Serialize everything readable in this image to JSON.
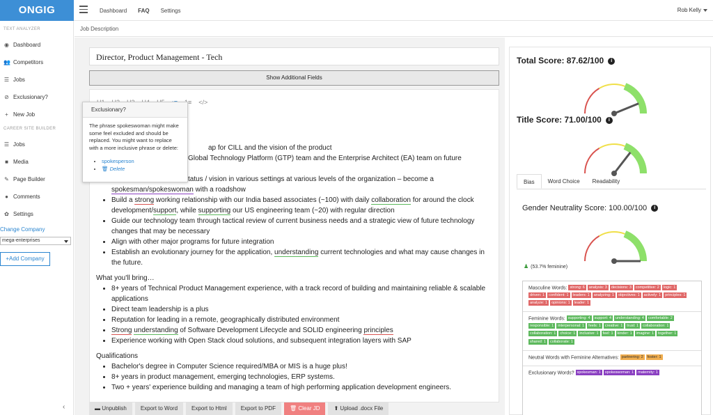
{
  "brand": {
    "logo": "ONGIG",
    "color": "#3d8fd6"
  },
  "nav": {
    "items": [
      "Dashboard",
      "FAQ",
      "Settings"
    ],
    "active": "FAQ",
    "user": "Rob Kelly"
  },
  "sidebar": {
    "section1": "TEXT ANALYZER",
    "items1": [
      {
        "icon": "dashboard-icon",
        "glyph": "◉",
        "label": "Dashboard"
      },
      {
        "icon": "users-icon",
        "glyph": "👥",
        "label": "Competitors"
      },
      {
        "icon": "list-icon",
        "glyph": "☰",
        "label": "Jobs"
      },
      {
        "icon": "ban-icon",
        "glyph": "⊘",
        "label": "Exclusionary?"
      },
      {
        "icon": "plus-icon",
        "glyph": "+",
        "label": "New Job"
      }
    ],
    "section2": "CAREER SITE BUILDER",
    "items2": [
      {
        "icon": "list-icon",
        "glyph": "☰",
        "label": "Jobs"
      },
      {
        "icon": "video-icon",
        "glyph": "■",
        "label": "Media"
      },
      {
        "icon": "wrench-icon",
        "glyph": "✎",
        "label": "Page Builder"
      },
      {
        "icon": "comment-icon",
        "glyph": "●",
        "label": "Comments"
      },
      {
        "icon": "gear-icon",
        "glyph": "✿",
        "label": "Settings"
      }
    ],
    "change_company": "Change Company",
    "company": "mega-enterprises",
    "add_company": "+Add Company"
  },
  "breadcrumb": "Job Description",
  "editor": {
    "title": "Director, Product Management - Tech",
    "show_fields": "Show Additional Fields",
    "toolbar": [
      "H1",
      "H2",
      "H3",
      "H4",
      "H5",
      "•≡",
      "1≡",
      "</>"
    ]
  },
  "popup": {
    "heading": "Exclusionary?",
    "body": "The phrase spokeswoman might make some feel excluded and should be replaced. You might want to replace with a more inclusive phrase or delete:",
    "option1": "spokesperson",
    "option2": "Delete"
  },
  "doc": {
    "line1_tail": "ap for CILL and the vision of the product",
    "line2_tail": "Global Technology Platform (GTP) team and the Enterprise Architect (EA) team on future",
    "line3_tail": "tatus / vision in various settings at various levels of the organization – become a",
    "line4_mark": "spokesman/spokeswoman",
    "line4_tail": " with a roadshow",
    "b2_a": "Build a ",
    "b2_strong": "strong",
    "b2_b": " working relationship with our India based associates (~100) with daily ",
    "b2_collab": "collaboration",
    "b2_c": " for around the clock development/",
    "b2_support": "support",
    "b2_d": ", while ",
    "b2_supporting": "supporting",
    "b2_e": " our US engineering team (~20) with regular direction",
    "b3": "Guide our technology team through tactical review of current business needs and a strategic view of future technology changes that may be necessary",
    "b4": "Align with other major programs for future integration",
    "b5_a": "Establish an evolutionary journey for the application, ",
    "b5_understanding": "understanding",
    "b5_b": " current technologies and what may cause changes in the future.",
    "section2": "What you'll bring…",
    "s2b1": "8+ years of Technical Product Management experience, with a track record of building and maintaining reliable & scalable applications",
    "s2b2": "Direct team leadership is a plus",
    "s2b3": "Reputation for leading in a remote, geographically distributed environment",
    "s2b4_strong": "Strong",
    "s2b4_understanding": "understanding",
    "s2b4_a": " of Software Development Lifecycle and SOLID engineering ",
    "s2b4_principles": "principles",
    "s2b5": "Experience working with Open Stack cloud solutions, and subsequent integration layers with SAP",
    "section3": "Qualifications",
    "s3b1": "Bachelor's degree in Computer Science required/MBA or MIS is a huge plus!",
    "s3b2": "8+ years in product management, emerging technologies, ERP systems.",
    "s3b3": "Two + years' experience building and managing a team of high performing application development engineers."
  },
  "bottom_buttons": [
    "Unpublish",
    "Export to Word",
    "Export to Html",
    "Export to PDF",
    "Clear JD",
    "Upload .docx File"
  ],
  "scores": {
    "total_label": "Total Score: 87.62/100",
    "total_value": 87.62,
    "title_label": "Title Score: 71.00/100",
    "title_value": 71.0,
    "gender_label": "Gender Neutrality Score: 100.00/100",
    "gender_value": 100.0
  },
  "tabs": [
    "Bias",
    "Word Choice",
    "Readability"
  ],
  "active_tab": "Bias",
  "feminine_note": "(53.7% feminine)",
  "word_boxes": {
    "masculine_label": "Masculine Words:",
    "masculine": [
      "strong: 6",
      "analysis: 3",
      "decisions: 3",
      "competitive: 2",
      "logic: 1",
      "driven: 1",
      "confident: 1",
      "leaders: 1",
      "analyzing: 1",
      "objectives: 1",
      "actively: 1",
      "principles: 1",
      "analyze: 1",
      "opinions: 1",
      "leader: 1"
    ],
    "feminine_label": "Feminine Words:",
    "feminine": [
      "supporting: 4",
      "support: 4",
      "understanding: 4",
      "comfortable: 2",
      "responsible: 1",
      "interpersonal: 1",
      "feels: 1",
      "creative: 1",
      "trust: 1",
      "collaboration: 1",
      "collaboration: 1",
      "choice: 1",
      "inclusive: 1",
      "feel: 1",
      "kinder: 1",
      "imagine: 1",
      "together: 1",
      "shared: 1",
      "collaborate: 1"
    ],
    "neutral_label": "Neutral Words with Feminine Alternatives:",
    "neutral": [
      "partnering: 2",
      "foster: 1"
    ],
    "exclusionary_label": "Exclusionary Words?",
    "exclusionary": [
      "spokesman: 1",
      "spokeswoman: 1",
      "maternity: 1"
    ]
  }
}
